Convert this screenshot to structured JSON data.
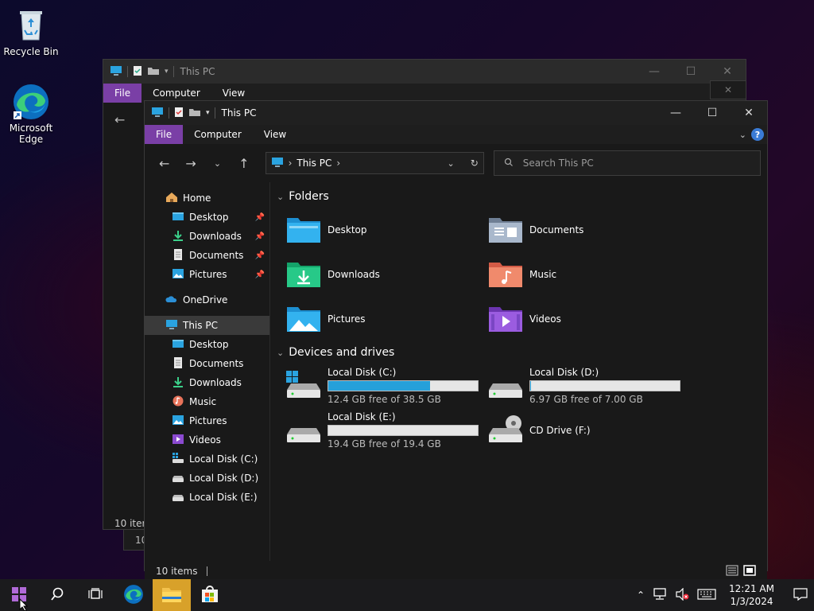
{
  "desktop": {
    "icons": [
      {
        "label": "Recycle Bin"
      },
      {
        "label": "Microsoft Edge"
      }
    ]
  },
  "back_window": {
    "title": "This PC",
    "tabs": [
      "File",
      "Computer",
      "View"
    ],
    "status": "10 items",
    "status2": "10"
  },
  "window": {
    "title": "This PC",
    "ribbon": {
      "file": "File",
      "computer": "Computer",
      "view": "View"
    },
    "address": "This PC",
    "search_placeholder": "Search This PC",
    "nav": {
      "home": "Home",
      "quick": [
        "Desktop",
        "Downloads",
        "Documents",
        "Pictures"
      ],
      "onedrive": "OneDrive",
      "thispc": "This PC",
      "pc_items": [
        "Desktop",
        "Documents",
        "Downloads",
        "Music",
        "Pictures",
        "Videos",
        "Local Disk (C:)",
        "Local Disk (D:)",
        "Local Disk (E:)"
      ]
    },
    "folders_header": "Folders",
    "folders": [
      "Desktop",
      "Documents",
      "Downloads",
      "Music",
      "Pictures",
      "Videos"
    ],
    "drives_header": "Devices and drives",
    "drives": [
      {
        "name": "Local Disk (C:)",
        "free": "12.4 GB free of 38.5 GB",
        "used_fraction": 0.68
      },
      {
        "name": "Local Disk (D:)",
        "free": "6.97 GB free of 7.00 GB",
        "used_fraction": 0.004
      },
      {
        "name": "Local Disk (E:)",
        "free": "19.4 GB free of 19.4 GB",
        "used_fraction": 0.0
      },
      {
        "name": "CD Drive (F:)"
      }
    ],
    "status": "10 items"
  },
  "taskbar": {
    "time": "12:21 AM",
    "date": "1/3/2024"
  }
}
